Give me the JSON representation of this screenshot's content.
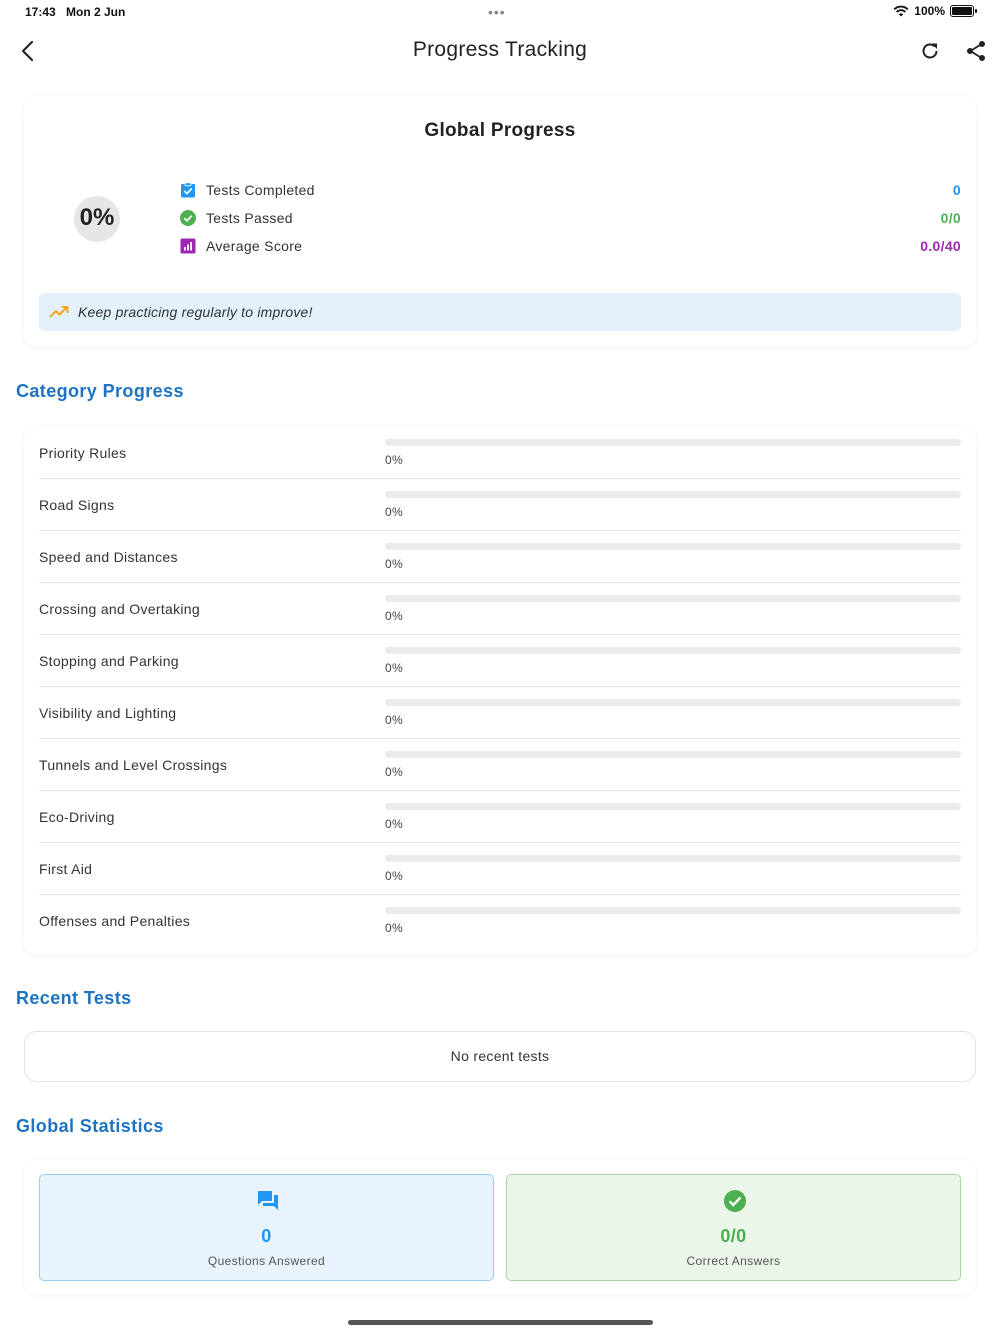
{
  "status_bar": {
    "time": "17:43",
    "date": "Mon 2 Jun",
    "battery": "100%"
  },
  "nav": {
    "title": "Progress Tracking",
    "back_icon": "chevron-left-icon",
    "refresh_icon": "refresh-icon",
    "share_icon": "share-icon"
  },
  "global": {
    "title": "Global Progress",
    "percent_label": "0%",
    "percent_value": 0,
    "stats": [
      {
        "label": "Tests Completed",
        "value": "0",
        "color": "#2196f3",
        "icon": "clipboard-check-icon"
      },
      {
        "label": "Tests Passed",
        "value": "0/0",
        "color": "#4caf50",
        "icon": "check-circle-icon"
      },
      {
        "label": "Average Score",
        "value": "0.0/40",
        "color": "#9c27b0",
        "icon": "bar-chart-icon"
      }
    ],
    "tip": {
      "text": "Keep practicing regularly to improve!",
      "icon": "trending-up-icon",
      "color": "#f5a623"
    }
  },
  "category": {
    "title": "Category Progress",
    "items": [
      {
        "name": "Priority Rules",
        "percent_label": "0%",
        "value": 0
      },
      {
        "name": "Road Signs",
        "percent_label": "0%",
        "value": 0
      },
      {
        "name": "Speed and Distances",
        "percent_label": "0%",
        "value": 0
      },
      {
        "name": "Crossing and Overtaking",
        "percent_label": "0%",
        "value": 0
      },
      {
        "name": "Stopping and Parking",
        "percent_label": "0%",
        "value": 0
      },
      {
        "name": "Visibility and Lighting",
        "percent_label": "0%",
        "value": 0
      },
      {
        "name": "Tunnels and Level Crossings",
        "percent_label": "0%",
        "value": 0
      },
      {
        "name": "Eco-Driving",
        "percent_label": "0%",
        "value": 0
      },
      {
        "name": "First Aid",
        "percent_label": "0%",
        "value": 0
      },
      {
        "name": "Offenses and Penalties",
        "percent_label": "0%",
        "value": 0
      }
    ]
  },
  "recent": {
    "title": "Recent Tests",
    "empty_text": "No recent tests"
  },
  "statistics": {
    "title": "Global Statistics",
    "questions": {
      "value": "0",
      "label": "Questions Answered",
      "color": "#2196f3",
      "icon": "forum-icon"
    },
    "correct": {
      "value": "0/0",
      "label": "Correct Answers",
      "color": "#4caf50",
      "icon": "check-circle-icon"
    }
  },
  "colors": {
    "accent": "#1e73c2"
  }
}
